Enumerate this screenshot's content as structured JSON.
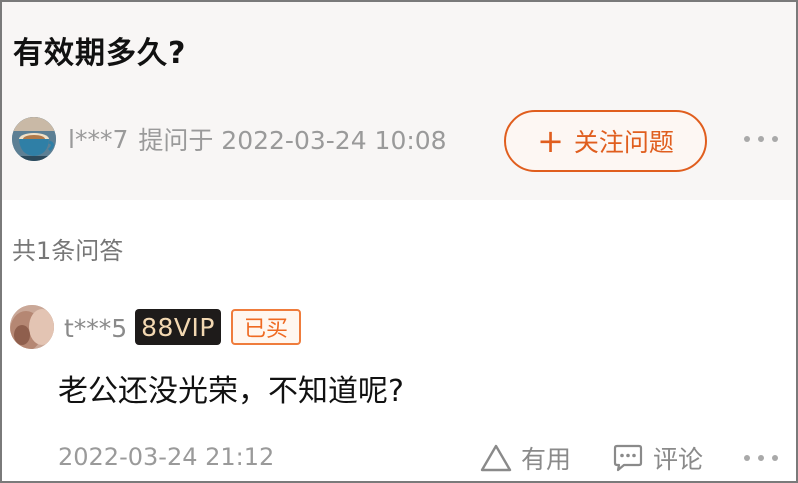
{
  "question": {
    "title": "有效期多久?",
    "asker_name": "l***7",
    "asked_label": "提问于 2022-03-24 10:08",
    "follow_label": "关注问题",
    "follow_icon": "plus-icon",
    "more_icon": "more-dots-icon",
    "accent_color": "#e05e1e"
  },
  "answers_summary": {
    "count_label": "共1条问答"
  },
  "answer": {
    "user_name": "t***5",
    "vip_badge": "88VIP",
    "bought_badge": "已买",
    "text": "老公还没光荣，不知道呢?",
    "time": "2022-03-24 21:12",
    "useful_label": "有用",
    "useful_icon": "triangle-up-icon",
    "comment_label": "评论",
    "comment_icon": "comment-bubble-icon",
    "more_icon": "more-dots-icon"
  }
}
